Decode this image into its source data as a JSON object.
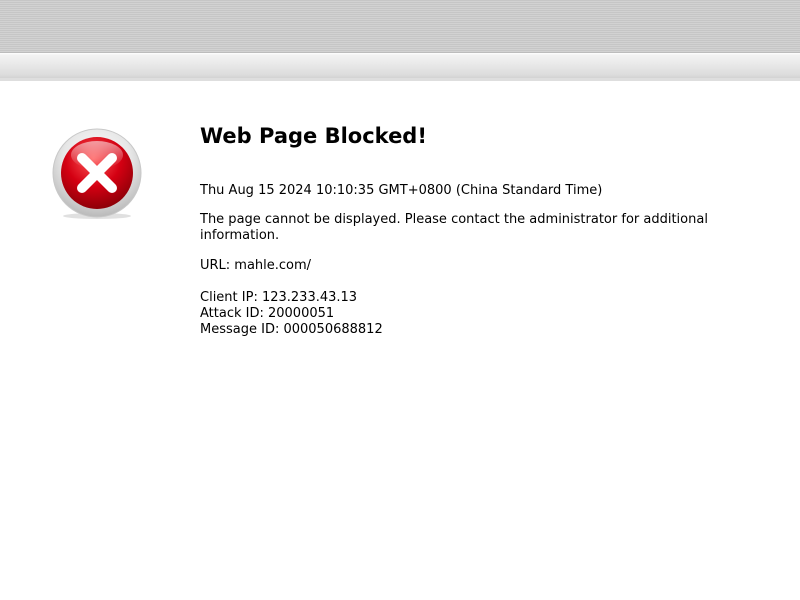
{
  "page": {
    "title": "Web Page Blocked!",
    "timestamp": "Thu Aug 15 2024 10:10:35 GMT+0800 (China Standard Time)",
    "message": "The page cannot be displayed. Please contact the administrator for additional information.",
    "url_line": "URL: mahle.com/",
    "client_ip": "Client IP: 123.233.43.13",
    "attack_id": "Attack ID: 20000051",
    "message_id": "Message ID: 000050688812"
  },
  "icons": {
    "block_icon": "error-x-icon"
  },
  "colors": {
    "icon_red": "#d40012",
    "icon_ring": "#d9d9d9",
    "header_gray": "#cccccc"
  }
}
